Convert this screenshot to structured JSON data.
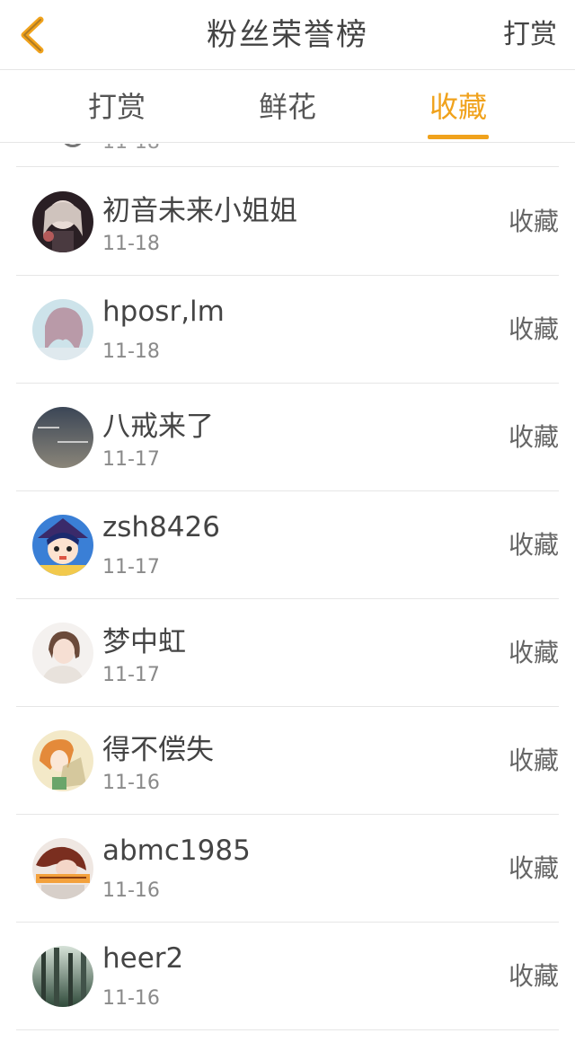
{
  "header": {
    "title": "粉丝荣誉榜",
    "right_link": "打赏"
  },
  "tabs": [
    {
      "label": "打赏",
      "active": false
    },
    {
      "label": "鲜花",
      "active": false
    },
    {
      "label": "收藏",
      "active": true
    }
  ],
  "colors": {
    "accent": "#f0a21c",
    "divider": "#e6e6e6"
  },
  "partial_row_date": "11-18",
  "fans": [
    {
      "name": "初音未来小姐姐",
      "date": "11-18",
      "action": "收藏",
      "avatar": "avatar-icon"
    },
    {
      "name": "hposr,lm",
      "date": "11-18",
      "action": "收藏",
      "avatar": "avatar-icon"
    },
    {
      "name": "八戒来了",
      "date": "11-17",
      "action": "收藏",
      "avatar": "avatar-icon"
    },
    {
      "name": "zsh8426",
      "date": "11-17",
      "action": "收藏",
      "avatar": "avatar-icon"
    },
    {
      "name": "梦中虹",
      "date": "11-17",
      "action": "收藏",
      "avatar": "avatar-icon"
    },
    {
      "name": "得不偿失",
      "date": "11-16",
      "action": "收藏",
      "avatar": "avatar-icon"
    },
    {
      "name": "abmc1985",
      "date": "11-16",
      "action": "收藏",
      "avatar": "avatar-icon"
    },
    {
      "name": "heer2",
      "date": "11-16",
      "action": "收藏",
      "avatar": "avatar-icon"
    }
  ]
}
